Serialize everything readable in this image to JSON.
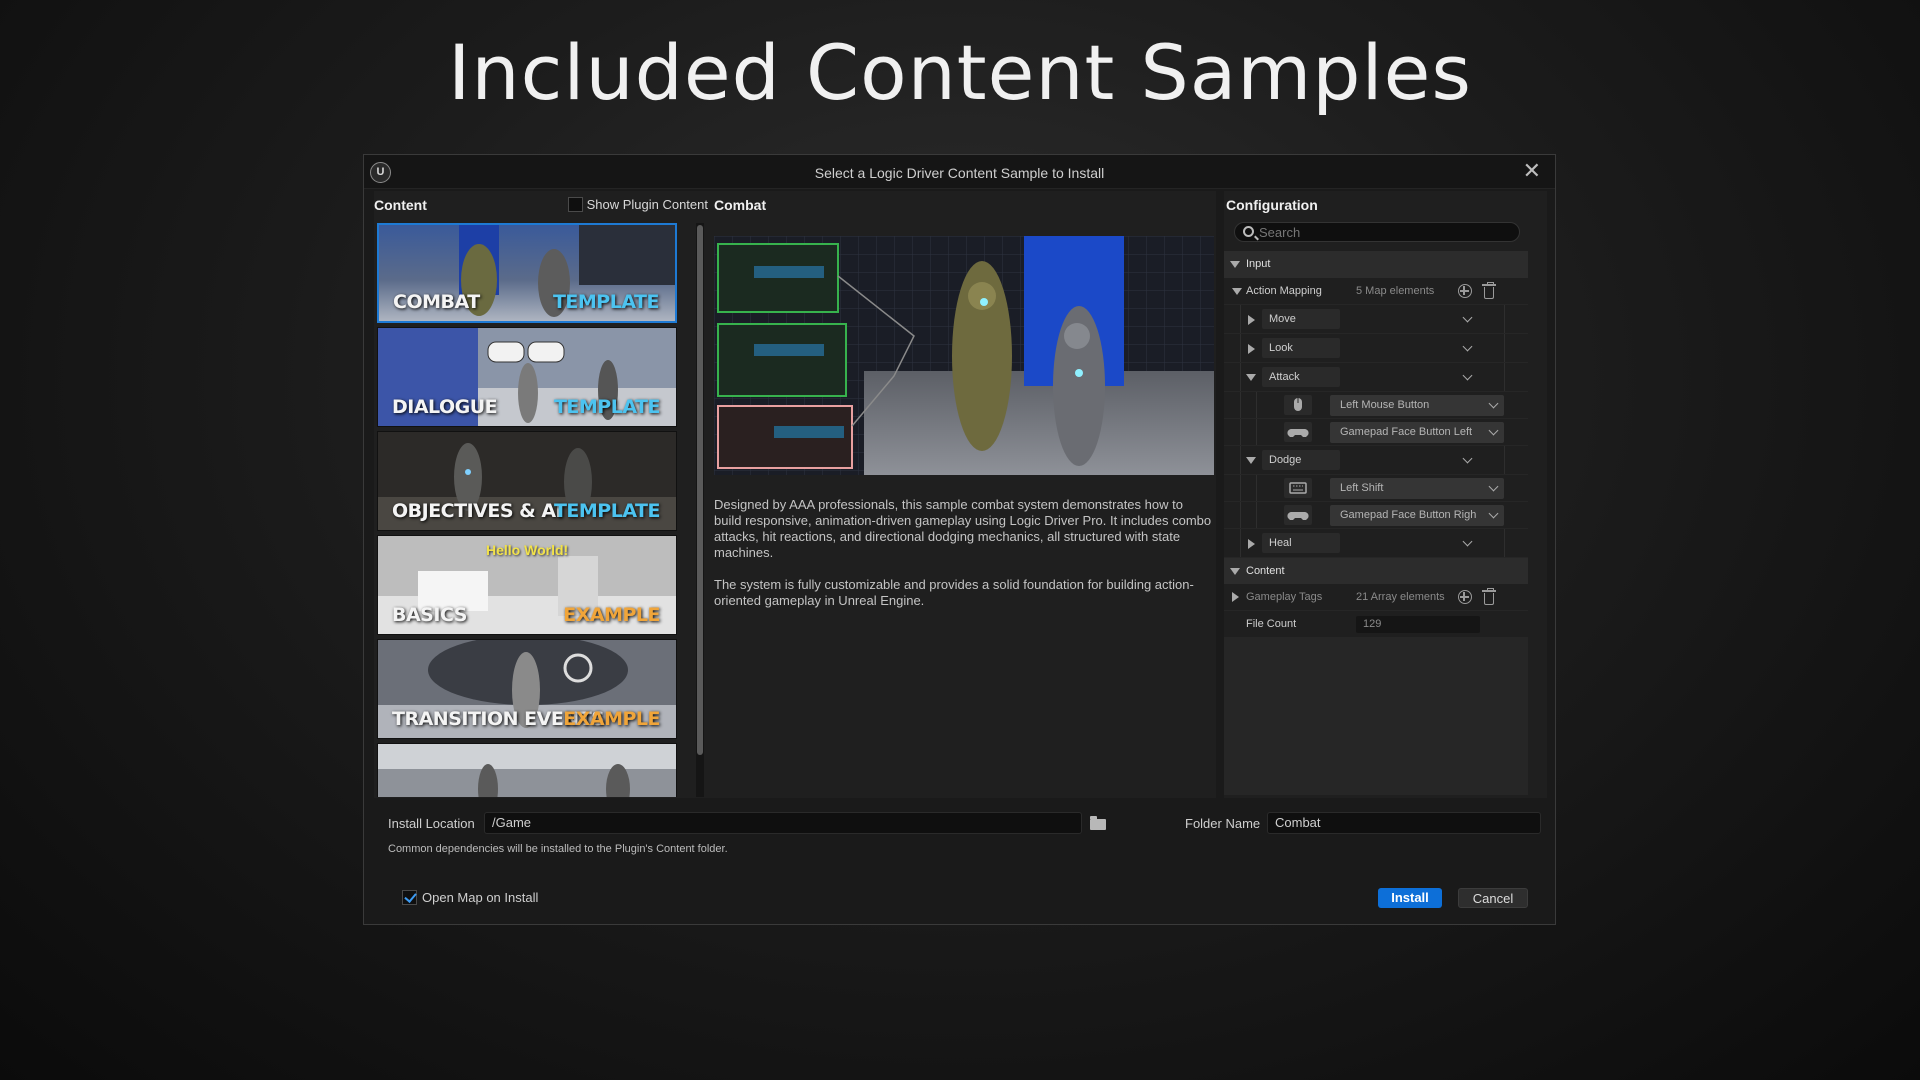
{
  "page": {
    "heading": "Included Content Samples"
  },
  "dialog": {
    "title": "Select a Logic Driver Content Sample to Install",
    "logo": "U",
    "close": "✕"
  },
  "content_panel": {
    "header": "Content",
    "show_plugin_content": "Show Plugin Content",
    "tiles": [
      {
        "name": "COMBAT",
        "tag": "TEMPLATE",
        "tag_color": "#4cc3f0"
      },
      {
        "name": "DIALOGUE",
        "tag": "TEMPLATE",
        "tag_color": "#4cc3f0"
      },
      {
        "name": "OBJECTIVES & AI",
        "tag": "TEMPLATE",
        "tag_color": "#4cc3f0"
      },
      {
        "name": "BASICS",
        "tag": "EXAMPLE",
        "tag_color": "#f0a53a"
      },
      {
        "name": "TRANSITION EVENTS",
        "tag": "EXAMPLE",
        "tag_color": "#f0a53a"
      },
      {
        "name": "",
        "tag": ""
      }
    ],
    "basics_overlay": "Hello World!"
  },
  "combat_panel": {
    "header": "Combat",
    "description": [
      "Designed by AAA professionals, this sample combat system demonstrates how to build responsive, animation-driven gameplay using Logic Driver Pro. It includes combo attacks, hit reactions, and directional dodging mechanics, all structured with state machines.",
      "The system is fully customizable and provides a solid foundation for building action-oriented gameplay in Unreal Engine."
    ]
  },
  "config_panel": {
    "header": "Configuration",
    "search_placeholder": "Search",
    "input_section": "Input",
    "action_mapping": {
      "label": "Action Mapping",
      "count": "5 Map elements"
    },
    "actions": [
      {
        "name": "Move"
      },
      {
        "name": "Look"
      },
      {
        "name": "Attack",
        "bindings": [
          {
            "icon": "mouse-icon",
            "key": "Left Mouse Button"
          },
          {
            "icon": "gamepad-icon",
            "key": "Gamepad Face Button Left"
          }
        ]
      },
      {
        "name": "Dodge",
        "bindings": [
          {
            "icon": "keyboard-icon",
            "key": "Left Shift"
          },
          {
            "icon": "gamepad-icon",
            "key": "Gamepad Face Button Righ"
          }
        ]
      },
      {
        "name": "Heal"
      }
    ],
    "content_section": "Content",
    "gameplay_tags": {
      "label": "Gameplay Tags",
      "count": "21 Array elements"
    },
    "file_count": {
      "label": "File Count",
      "value": "129"
    }
  },
  "footer": {
    "install_location_label": "Install Location",
    "install_location_value": "/Game",
    "folder_name_label": "Folder Name",
    "folder_name_value": "Combat",
    "note": "Common dependencies will be installed to the Plugin's Content folder.",
    "open_map_label": "Open Map on Install",
    "install_button": "Install",
    "cancel_button": "Cancel"
  },
  "colors": {
    "accent": "#0d6fd8",
    "selected_border": "#1e7ad4"
  }
}
